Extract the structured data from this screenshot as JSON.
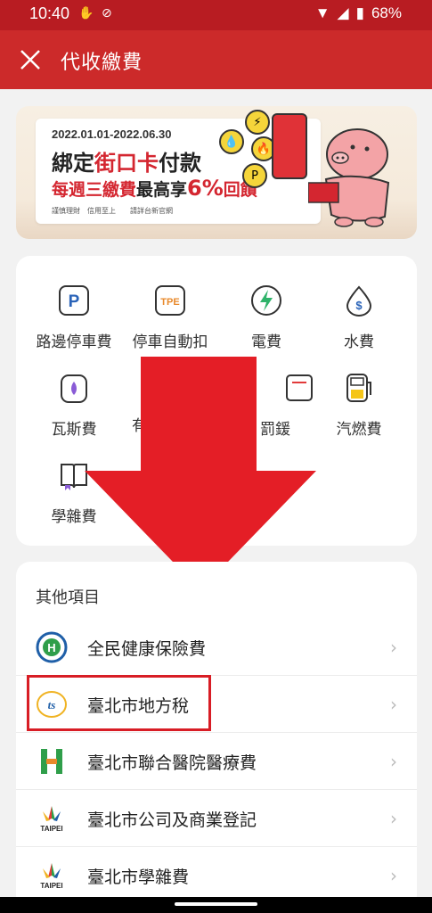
{
  "status": {
    "time": "10:40",
    "battery": "68%",
    "icons": [
      "hand-icon",
      "do-not-disturb-icon",
      "wifi-icon",
      "signal-icon",
      "battery-icon"
    ]
  },
  "appbar": {
    "title": "代收繳費",
    "close_icon": "close-icon"
  },
  "banner": {
    "date": "2022.01.01-2022.06.30",
    "headline_pre": "綁定",
    "headline_red": "街口卡",
    "headline_post": "付款",
    "sub_pre": "每週三繳費",
    "sub_dark": "最高享",
    "sub_pct": "6%",
    "sub_post": "回饋",
    "disclaimer": "謹慎理財　信用至上　　請詳台新官網"
  },
  "services": [
    {
      "label": "路邊停車費",
      "icon": "parking-icon"
    },
    {
      "label": "停車自動扣",
      "icon": "tpe-icon"
    },
    {
      "label": "電費",
      "icon": "lightning-icon"
    },
    {
      "label": "水費",
      "icon": "water-drop-icon"
    },
    {
      "label": "瓦斯費",
      "icon": "gas-meter-icon"
    },
    {
      "label": "有",
      "icon": "phone-bill-icon"
    },
    {
      "label": "罰鍰",
      "icon": "ticket-icon"
    },
    {
      "label": "汽燃費",
      "icon": "fuel-pump-icon"
    },
    {
      "label": "學雜費",
      "icon": "book-icon"
    }
  ],
  "other": {
    "heading": "其他項目",
    "items": [
      {
        "label": "全民健康保險費",
        "icon": "nhi-logo-icon"
      },
      {
        "label": "臺北市地方稅",
        "icon": "taipei-tax-logo-icon"
      },
      {
        "label": "臺北市聯合醫院醫療費",
        "icon": "taipei-hospital-logo-icon"
      },
      {
        "label": "臺北市公司及商業登記",
        "icon": "taipei-logo-icon"
      },
      {
        "label": "臺北市學雜費",
        "icon": "taipei-logo-icon"
      }
    ],
    "chevron": "›"
  },
  "colors": {
    "brand_red": "#cc2a2a",
    "status_red": "#b81c22",
    "highlight": "#d81d25",
    "arrow": "#e41e26"
  }
}
